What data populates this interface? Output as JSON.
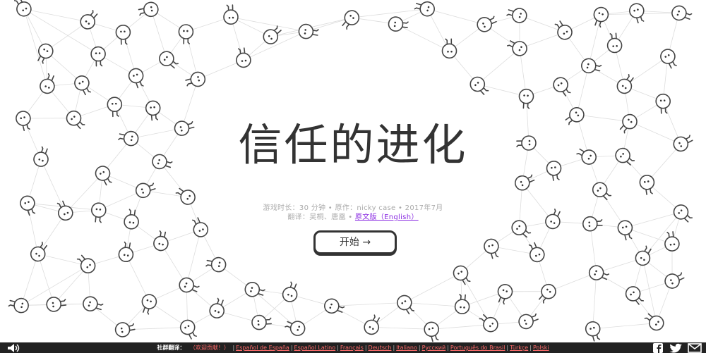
{
  "title": "信任的进化",
  "meta": {
    "line1": "游戏时长：30 分钟 • 原作：nicky case • 2017年7月",
    "line2_prefix": "翻译：吴桐、唐凰 •",
    "original_link": "原文版（English）"
  },
  "start_button": "开始 →",
  "footer": {
    "label": "社群翻译：",
    "thanks": "（欢迎贡献！）",
    "languages": [
      "Español de España",
      "Español Latino",
      "Français",
      "Deutsch",
      "Italiano",
      "Русский",
      "Português do Brasil",
      "Türkçe",
      "Polski"
    ]
  },
  "icons": [
    "sound-icon",
    "facebook-icon",
    "twitter-icon",
    "email-icon"
  ]
}
